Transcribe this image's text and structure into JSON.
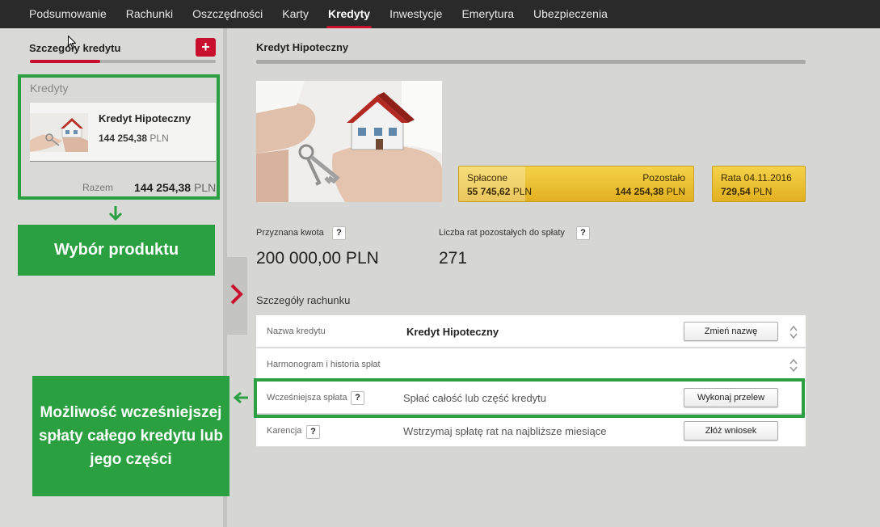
{
  "nav": {
    "items": [
      {
        "label": "Podsumowanie",
        "active": false
      },
      {
        "label": "Rachunki",
        "active": false
      },
      {
        "label": "Oszczędności",
        "active": false
      },
      {
        "label": "Karty",
        "active": false
      },
      {
        "label": "Kredyty",
        "active": true
      },
      {
        "label": "Inwestycje",
        "active": false
      },
      {
        "label": "Emerytura",
        "active": false
      },
      {
        "label": "Ubezpieczenia",
        "active": false
      }
    ]
  },
  "sidebar": {
    "title": "Szczegóły kredytu",
    "add_label": "+",
    "loans_label": "Kredyty",
    "loan": {
      "name": "Kredyt Hipoteczny",
      "amount": "144 254,38",
      "currency": "PLN"
    },
    "sum_label": "Razem",
    "sum_amount": "144 254,38",
    "sum_currency": "PLN"
  },
  "annotations": {
    "product_choice": "Wybór produktu",
    "early_repayment": "Możliwość wcześniejszej spłaty całego kredytu lub jego części"
  },
  "main": {
    "title": "Kredyt Hipoteczny",
    "summary": {
      "paid_label": "Spłacone",
      "paid_value": "55 745,62",
      "remaining_label": "Pozostało",
      "remaining_value": "144 254,38",
      "currency": "PLN",
      "installment_label": "Rata 04.11.2016",
      "installment_value": "729,54"
    },
    "granted_label": "Przyznana kwota",
    "granted_value": "200 000,00 PLN",
    "remaining_installments_label": "Liczba rat pozostałych do spłaty",
    "remaining_installments_value": "271",
    "help_label": "?",
    "details_title": "Szczegóły rachunku",
    "rows": [
      {
        "label": "Nazwa kredytu",
        "value": "Kredyt Hipoteczny",
        "button": "Zmień nazwę"
      },
      {
        "label": "Harmonogram i historia spłat",
        "value": "",
        "button": ""
      },
      {
        "label": "Wcześniejsza spłata",
        "value": "Spłać całość lub część kredytu",
        "button": "Wykonaj przelew"
      },
      {
        "label": "Karencja",
        "value": "Wstrzymaj spłatę rat na najbliższe miesiące",
        "button": "Złóż wniosek"
      }
    ]
  },
  "colors": {
    "accent": "#c8102e",
    "green": "#2aa041",
    "gold": "#e8c030"
  }
}
